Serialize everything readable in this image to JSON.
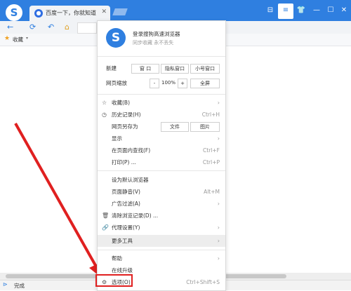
{
  "browser": {
    "tab_title": "百度一下，你就知道",
    "tab_close": "✕",
    "window_controls": [
      "⊟",
      "≡",
      "👕",
      "—",
      "☐",
      "✕"
    ],
    "nav_icons": [
      "←",
      "⟳",
      "↶",
      "⌂"
    ],
    "bookmark_label": "收藏",
    "status_text": "完成"
  },
  "menu": {
    "user": {
      "title": "登录搜狗高速浏览器",
      "subtitle": "同步收藏 永不丢失"
    },
    "new": {
      "label": "新建",
      "buttons": [
        "窗 口",
        "隐私窗口",
        "小号窗口"
      ]
    },
    "zoom": {
      "label": "网页缩放",
      "minus": "-",
      "value": "100%",
      "plus": "+",
      "fullscreen": "全屏"
    },
    "items1": [
      {
        "icon": "☆",
        "label": "收藏(B)",
        "right": "›"
      },
      {
        "icon": "◷",
        "label": "历史记录(H)",
        "right": "Ctrl+H"
      }
    ],
    "save_as": {
      "label": "网页另存为",
      "buttons": [
        "文件",
        "图片"
      ]
    },
    "items2": [
      {
        "label": "显示",
        "right": "›"
      },
      {
        "label": "在页面内查找(F)",
        "right": "Ctrl+F"
      },
      {
        "label": "打印(P) ...",
        "right": "Ctrl+P"
      }
    ],
    "items3": [
      {
        "icon": "",
        "label": "设为默认浏览器",
        "right": ""
      },
      {
        "icon": "",
        "label": "页面静音(V)",
        "right": "Alt+M"
      },
      {
        "icon": "",
        "label": "广告过滤(A)",
        "right": "›"
      },
      {
        "icon": "🗑",
        "label": "清除浏览记录(D) ...",
        "right": ""
      },
      {
        "icon": "🔗",
        "label": "代理设置(Y)",
        "right": "›"
      },
      {
        "icon": "",
        "label": "更多工具",
        "right": "›"
      }
    ],
    "items4": [
      {
        "icon": "",
        "label": "帮助",
        "right": "›"
      },
      {
        "icon": "",
        "label": "在线升级",
        "right": ""
      },
      {
        "icon": "⚙",
        "label": "选项(O)",
        "right": "Ctrl+Shift+S"
      }
    ]
  },
  "colors": {
    "brand": "#2f7fe0",
    "highlight": "#e02020",
    "arrow": "#e02020"
  }
}
